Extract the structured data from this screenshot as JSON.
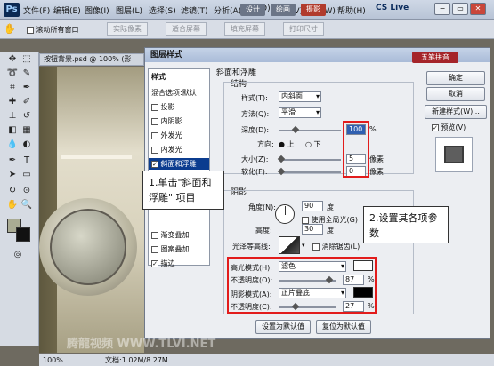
{
  "menubar": {
    "logo": "Ps",
    "items": [
      "文件(F)",
      "编辑(E)",
      "图像(I)",
      "图层(L)",
      "选择(S)",
      "滤镜(T)",
      "分析(A)",
      "3D(D)",
      "视图(V)",
      "窗口(W)",
      "帮助(H)"
    ],
    "modes": [
      "设计",
      "绘画",
      "摄影"
    ],
    "cs_live": "CS Live",
    "window_controls": [
      "−",
      "▭",
      "✕"
    ]
  },
  "optionsbar": {
    "scroll_all": "滚动所有窗口",
    "actual_pixels": "实际像素",
    "fit_screen": "适合屏幕",
    "fill_screen": "填充屏幕",
    "print_size": "打印尺寸"
  },
  "document": {
    "tab": "按钮背景.psd @ 100% (形",
    "zoom": "100%",
    "doc_info": "文档:1.02M/8.27M"
  },
  "dialog": {
    "title": "图层样式",
    "styles_header": "样式",
    "blend_default": "混合选项:默认",
    "style_items": [
      {
        "label": "投影",
        "checked": false
      },
      {
        "label": "内阴影",
        "checked": false
      },
      {
        "label": "外发光",
        "checked": false
      },
      {
        "label": "内发光",
        "checked": false
      },
      {
        "label": "斜面和浮雕",
        "checked": true
      },
      {
        "label": "渐变叠加",
        "checked": false
      },
      {
        "label": "图案叠加",
        "checked": false
      },
      {
        "label": "描边",
        "checked": true
      }
    ],
    "bevel": {
      "group_title": "斜面和浮雕",
      "structure": "结构",
      "style_label": "样式(T):",
      "style_value": "内斜面",
      "method_label": "方法(Q):",
      "method_value": "平滑",
      "depth_label": "深度(D):",
      "depth_value": "100",
      "pct": "%",
      "direction_label": "方向:",
      "dir_up": "上",
      "dir_down": "下",
      "size_label": "大小(Z):",
      "size_value": "5",
      "soften_label": "软化(F):",
      "soften_value": "0",
      "px": "像素"
    },
    "shading": {
      "title": "阴影",
      "angle_label": "角度(N):",
      "angle_value": "90",
      "deg": "度",
      "global_light": "使用全局光(G)",
      "altitude_label": "高度:",
      "altitude_value": "30",
      "gloss_label": "光泽等高线:",
      "anti_alias": "消除锯齿(L)",
      "highlight_mode_label": "高光模式(H):",
      "highlight_mode": "滤色",
      "highlight_color": "#ffffff",
      "opacity_label": "不透明度(O):",
      "highlight_opacity": "87",
      "shadow_mode_label": "阴影模式(A):",
      "shadow_mode": "正片叠底",
      "shadow_color": "#000000",
      "shadow_opacity_label": "不透明度(C):",
      "shadow_opacity": "27"
    },
    "buttons": {
      "ok": "确定",
      "cancel": "取消",
      "new_style": "新建样式(W)...",
      "preview": "预览(V)",
      "set_default": "设置为默认值",
      "reset_default": "复位为默认值"
    },
    "ime_badge": "五笔拼音"
  },
  "callouts": {
    "step1": "1.单击\"斜面和浮雕\" 项目",
    "step2": "2.设置其各项参数"
  },
  "watermark": "腾龍视频 WWW.TLVI.NET",
  "colors": {
    "accent_red": "#e21c1c",
    "selection_blue": "#0b3c8f"
  }
}
